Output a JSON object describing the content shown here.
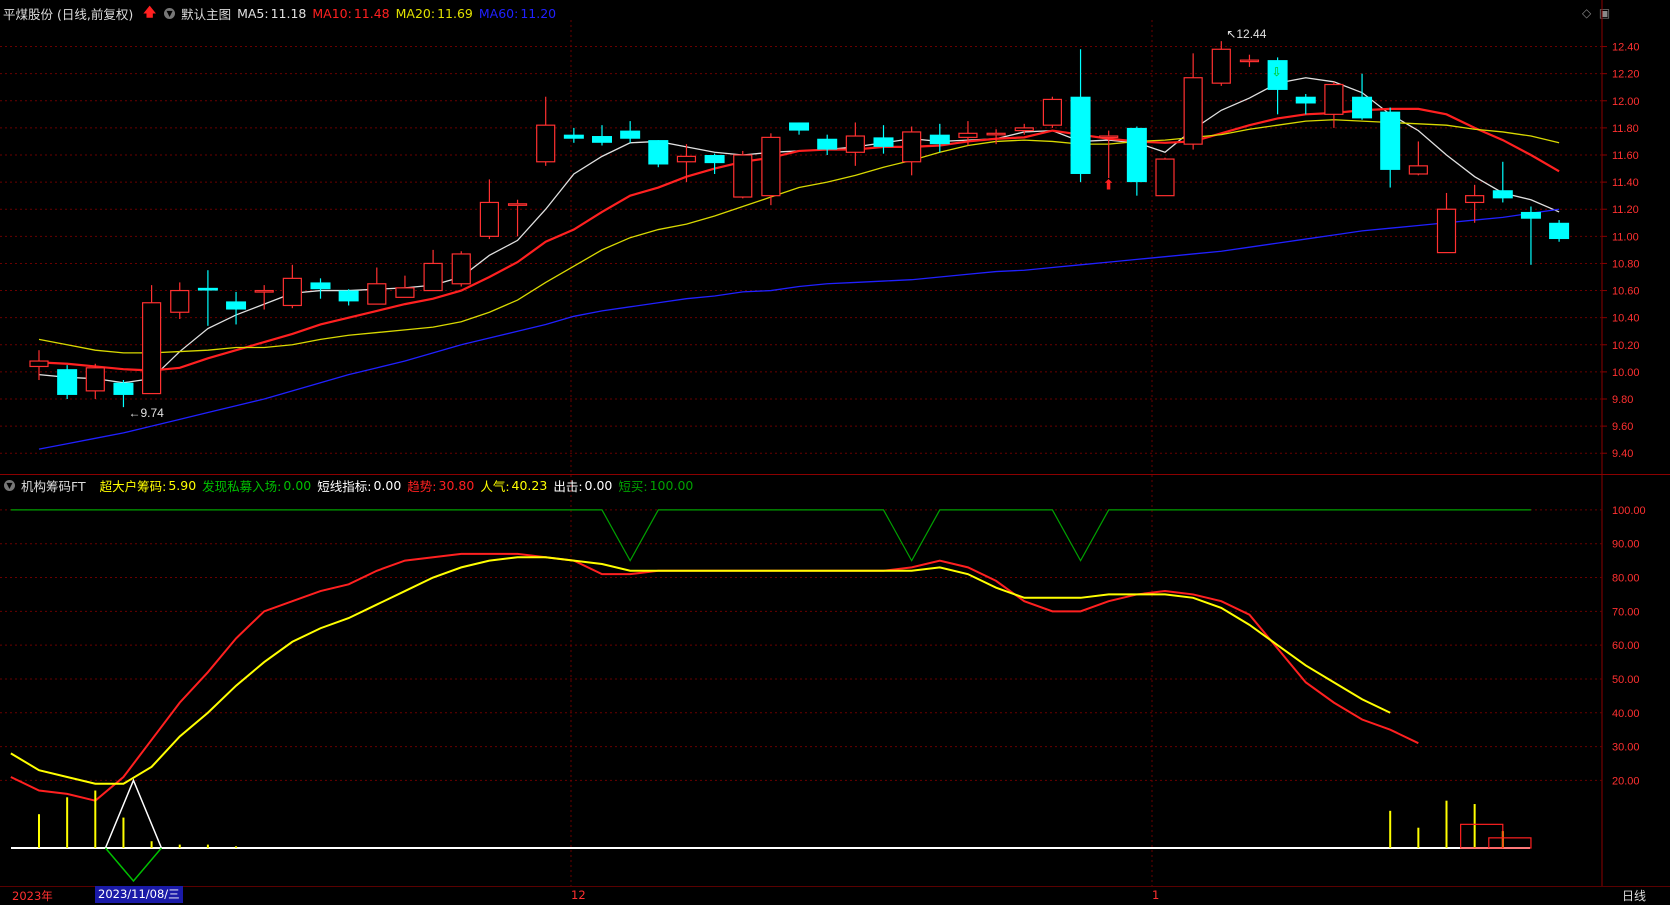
{
  "header": {
    "stock_name": "平煤股份 (日线,前复权)",
    "template": "默认主图",
    "ma5_label": "MA5:",
    "ma5_value": "11.18",
    "ma10_label": "MA10:",
    "ma10_value": "11.48",
    "ma20_label": "MA20:",
    "ma20_value": "11.69",
    "ma60_label": "MA60:",
    "ma60_value": "11.20"
  },
  "indicator_header": {
    "name": "机构筹码FT",
    "items": [
      {
        "label": "超大户筹码:",
        "value": "5.90",
        "color": "#ffff00"
      },
      {
        "label": "发现私募入场:",
        "value": "0.00",
        "color": "#00c000"
      },
      {
        "label": "短线指标:",
        "value": "0.00",
        "color": "#ffffff"
      },
      {
        "label": "趋势:",
        "value": "30.80",
        "color": "#ff2020"
      },
      {
        "label": "人气:",
        "value": "40.23",
        "color": "#ffff00"
      },
      {
        "label": "出击:",
        "value": "0.00",
        "color": "#ffffff"
      },
      {
        "label": "短买:",
        "value": "100.00",
        "color": "#00a000"
      }
    ]
  },
  "xaxis": {
    "year": "2023年",
    "date": "2023/11/08/三",
    "m12": "12",
    "m1": "1",
    "period": "日线"
  },
  "icons": [
    "info-icon",
    "up-arrow-icon",
    "template-icon",
    "diamond-icon",
    "window-icon"
  ],
  "chart_data": [
    {
      "type": "candlestick",
      "ylim": [
        9.35,
        12.5
      ],
      "yticks": [
        "12.40",
        "12.20",
        "12.00",
        "11.80",
        "11.60",
        "11.40",
        "11.20",
        "11.00",
        "10.80",
        "10.60",
        "10.40",
        "10.20",
        "10.00",
        "9.80",
        "9.60",
        "9.40"
      ],
      "annotations": [
        {
          "text": "←9.74",
          "bar": 3
        },
        {
          "text": "↖12.44",
          "bar": 42
        }
      ],
      "up_color": "#ff3030",
      "down_color": "#00ffff",
      "candles": [
        [
          10.04,
          10.08,
          10.16,
          9.94
        ],
        [
          10.02,
          9.83,
          10.05,
          9.8
        ],
        [
          9.86,
          10.03,
          10.06,
          9.8
        ],
        [
          9.92,
          9.83,
          9.94,
          9.74
        ],
        [
          9.84,
          10.51,
          10.64,
          9.84
        ],
        [
          10.44,
          10.6,
          10.66,
          10.39
        ],
        [
          10.62,
          10.6,
          10.75,
          10.34
        ],
        [
          10.52,
          10.46,
          10.59,
          10.35
        ],
        [
          10.6,
          10.6,
          10.64,
          10.46
        ],
        [
          10.49,
          10.69,
          10.79,
          10.47
        ],
        [
          10.66,
          10.61,
          10.69,
          10.54
        ],
        [
          10.6,
          10.52,
          10.61,
          10.49
        ],
        [
          10.5,
          10.65,
          10.77,
          10.5
        ],
        [
          10.55,
          10.62,
          10.71,
          10.55
        ],
        [
          10.6,
          10.8,
          10.9,
          10.6
        ],
        [
          10.65,
          10.87,
          10.89,
          10.63
        ],
        [
          11.0,
          11.25,
          11.42,
          10.98
        ],
        [
          11.23,
          11.24,
          11.27,
          11.0
        ],
        [
          11.55,
          11.82,
          12.03,
          11.52
        ],
        [
          11.75,
          11.72,
          11.8,
          11.69
        ],
        [
          11.74,
          11.69,
          11.82,
          11.67
        ],
        [
          11.78,
          11.72,
          11.85,
          11.69
        ],
        [
          11.71,
          11.53,
          11.71,
          11.51
        ],
        [
          11.55,
          11.59,
          11.68,
          11.4
        ],
        [
          11.6,
          11.54,
          11.61,
          11.46
        ],
        [
          11.29,
          11.6,
          11.63,
          11.28
        ],
        [
          11.3,
          11.73,
          11.76,
          11.23
        ],
        [
          11.84,
          11.78,
          11.84,
          11.75
        ],
        [
          11.72,
          11.64,
          11.75,
          11.6
        ],
        [
          11.62,
          11.74,
          11.84,
          11.52
        ],
        [
          11.73,
          11.66,
          11.82,
          11.61
        ],
        [
          11.55,
          11.77,
          11.81,
          11.45
        ],
        [
          11.75,
          11.68,
          11.83,
          11.62
        ],
        [
          11.73,
          11.76,
          11.85,
          11.67
        ],
        [
          11.76,
          11.76,
          11.79,
          11.68
        ],
        [
          11.78,
          11.8,
          11.83,
          11.75
        ],
        [
          11.82,
          12.01,
          12.03,
          11.8
        ],
        [
          12.03,
          11.46,
          12.38,
          11.4
        ],
        [
          11.73,
          11.74,
          11.78,
          11.43
        ],
        [
          11.8,
          11.4,
          11.81,
          11.3
        ],
        [
          11.3,
          11.57,
          11.58,
          11.3
        ],
        [
          11.68,
          12.17,
          12.35,
          11.64
        ],
        [
          12.13,
          12.38,
          12.44,
          12.11
        ],
        [
          12.3,
          12.3,
          12.34,
          12.25
        ],
        [
          12.3,
          12.08,
          12.32,
          11.9
        ],
        [
          12.03,
          11.98,
          12.05,
          11.9
        ],
        [
          11.9,
          12.12,
          12.14,
          11.8
        ],
        [
          12.03,
          11.87,
          12.2,
          11.86
        ],
        [
          11.92,
          11.49,
          11.95,
          11.36
        ],
        [
          11.46,
          11.52,
          11.7,
          11.45
        ],
        [
          10.88,
          11.2,
          11.32,
          10.88
        ],
        [
          11.25,
          11.3,
          11.38,
          11.1
        ],
        [
          11.34,
          11.28,
          11.55,
          11.25
        ],
        [
          11.18,
          11.13,
          11.22,
          10.79
        ],
        [
          11.1,
          10.98,
          11.12,
          10.96
        ]
      ],
      "ma_lines": [
        {
          "name": "MA5",
          "color": "#e0e0e0",
          "values": [
            9.98,
            9.96,
            9.95,
            9.92,
            9.95,
            10.15,
            10.32,
            10.42,
            10.5,
            10.58,
            10.6,
            10.6,
            10.61,
            10.62,
            10.64,
            10.7,
            10.86,
            10.97,
            11.2,
            11.46,
            11.59,
            11.69,
            11.7,
            11.66,
            11.62,
            11.6,
            11.62,
            11.63,
            11.64,
            11.66,
            11.69,
            11.72,
            11.7,
            11.71,
            11.72,
            11.77,
            11.78,
            11.7,
            11.71,
            11.69,
            11.62,
            11.79,
            11.93,
            12.02,
            12.13,
            12.17,
            12.14,
            12.06,
            11.9,
            11.78,
            11.6,
            11.44,
            11.32,
            11.27,
            11.18
          ]
        },
        {
          "name": "MA10",
          "color": "#ff2020",
          "values": [
            10.07,
            10.06,
            10.04,
            10.02,
            10.01,
            10.03,
            10.1,
            10.16,
            10.22,
            10.28,
            10.35,
            10.4,
            10.45,
            10.5,
            10.54,
            10.6,
            10.7,
            10.81,
            10.96,
            11.05,
            11.18,
            11.3,
            11.36,
            11.44,
            11.5,
            11.55,
            11.58,
            11.63,
            11.64,
            11.64,
            11.66,
            11.66,
            11.67,
            11.7,
            11.72,
            11.73,
            11.78,
            11.75,
            11.72,
            11.7,
            11.69,
            11.7,
            11.76,
            11.82,
            11.87,
            11.9,
            11.91,
            11.93,
            11.94,
            11.94,
            11.9,
            11.8,
            11.71,
            11.6,
            11.48
          ]
        },
        {
          "name": "MA20",
          "color": "#d8d800",
          "values": [
            10.24,
            10.2,
            10.16,
            10.14,
            10.14,
            10.15,
            10.16,
            10.18,
            10.18,
            10.2,
            10.24,
            10.27,
            10.29,
            10.31,
            10.33,
            10.37,
            10.44,
            10.53,
            10.66,
            10.78,
            10.9,
            10.99,
            11.05,
            11.09,
            11.15,
            11.22,
            11.29,
            11.36,
            11.4,
            11.45,
            11.51,
            11.56,
            11.62,
            11.67,
            11.7,
            11.71,
            11.7,
            11.68,
            11.68,
            11.7,
            11.71,
            11.73,
            11.75,
            11.79,
            11.82,
            11.85,
            11.86,
            11.85,
            11.84,
            11.83,
            11.82,
            11.79,
            11.77,
            11.74,
            11.69
          ]
        },
        {
          "name": "MA60",
          "color": "#2020ff",
          "values": [
            9.43,
            9.47,
            9.51,
            9.55,
            9.6,
            9.65,
            9.7,
            9.75,
            9.8,
            9.86,
            9.92,
            9.98,
            10.03,
            10.08,
            10.14,
            10.2,
            10.25,
            10.3,
            10.35,
            10.41,
            10.45,
            10.48,
            10.51,
            10.54,
            10.56,
            10.59,
            10.6,
            10.63,
            10.65,
            10.66,
            10.67,
            10.68,
            10.7,
            10.72,
            10.74,
            10.75,
            10.77,
            10.79,
            10.81,
            10.83,
            10.85,
            10.87,
            10.89,
            10.92,
            10.95,
            10.98,
            11.01,
            11.04,
            11.06,
            11.08,
            11.1,
            11.12,
            11.14,
            11.17,
            11.2
          ]
        }
      ]
    },
    {
      "type": "line",
      "ylim": [
        0,
        105
      ],
      "yticks": [
        "100.00",
        "90.00",
        "80.00",
        "70.00",
        "60.00",
        "50.00",
        "40.00",
        "30.00",
        "20.00"
      ],
      "series": [
        {
          "name": "趋势",
          "color": "#ff2020",
          "values": [
            21,
            17,
            16,
            14,
            21,
            32,
            43,
            52,
            62,
            70,
            73,
            76,
            78,
            82,
            85,
            86,
            87,
            87,
            87,
            86,
            85,
            81,
            81,
            82,
            82,
            82,
            82,
            82,
            82,
            82,
            82,
            82,
            83,
            85,
            83,
            79,
            73,
            70,
            70,
            73,
            75,
            76,
            75,
            73,
            69,
            59,
            49,
            43,
            38,
            35,
            31
          ]
        },
        {
          "name": "人气",
          "color": "#ffff00",
          "values": [
            28,
            23,
            21,
            19,
            19,
            24,
            33,
            40,
            48,
            55,
            61,
            65,
            68,
            72,
            76,
            80,
            83,
            85,
            86,
            86,
            85,
            84,
            82,
            82,
            82,
            82,
            82,
            82,
            82,
            82,
            82,
            82,
            82,
            83,
            81,
            77,
            74,
            74,
            74,
            75,
            75,
            75,
            74,
            71,
            66,
            60,
            54,
            49,
            44,
            40
          ]
        },
        {
          "name": "短买",
          "color": "#00a000",
          "values": [
            100,
            100,
            100,
            100,
            100,
            100,
            100,
            100,
            100,
            100,
            100,
            100,
            100,
            100,
            100,
            100,
            100,
            100,
            100,
            100,
            100,
            100,
            85,
            100,
            100,
            100,
            100,
            100,
            100,
            100,
            100,
            100,
            85,
            100,
            100,
            100,
            100,
            100,
            85,
            100,
            100,
            100,
            100,
            100,
            100,
            100,
            100,
            100,
            100,
            100,
            100,
            100,
            100,
            100,
            100
          ]
        }
      ],
      "yellow_bars": [
        {
          "bar": 1,
          "value": 10
        },
        {
          "bar": 2,
          "value": 15
        },
        {
          "bar": 3,
          "value": 17
        },
        {
          "bar": 4,
          "value": 9
        },
        {
          "bar": 5,
          "value": 2
        },
        {
          "bar": 6,
          "value": 1
        },
        {
          "bar": 7,
          "value": 1
        },
        {
          "bar": 8,
          "value": 0.5
        },
        {
          "bar": 49,
          "value": 11
        },
        {
          "bar": 50,
          "value": 6
        },
        {
          "bar": 51,
          "value": 14
        },
        {
          "bar": 52,
          "value": 13
        },
        {
          "bar": 53,
          "value": 5
        }
      ],
      "red_boxes": [
        {
          "from": 52,
          "to": 53,
          "value": 7
        },
        {
          "from": 53,
          "to": 54,
          "value": 3
        }
      ],
      "signal_bar": 4,
      "baseline": 0
    }
  ]
}
